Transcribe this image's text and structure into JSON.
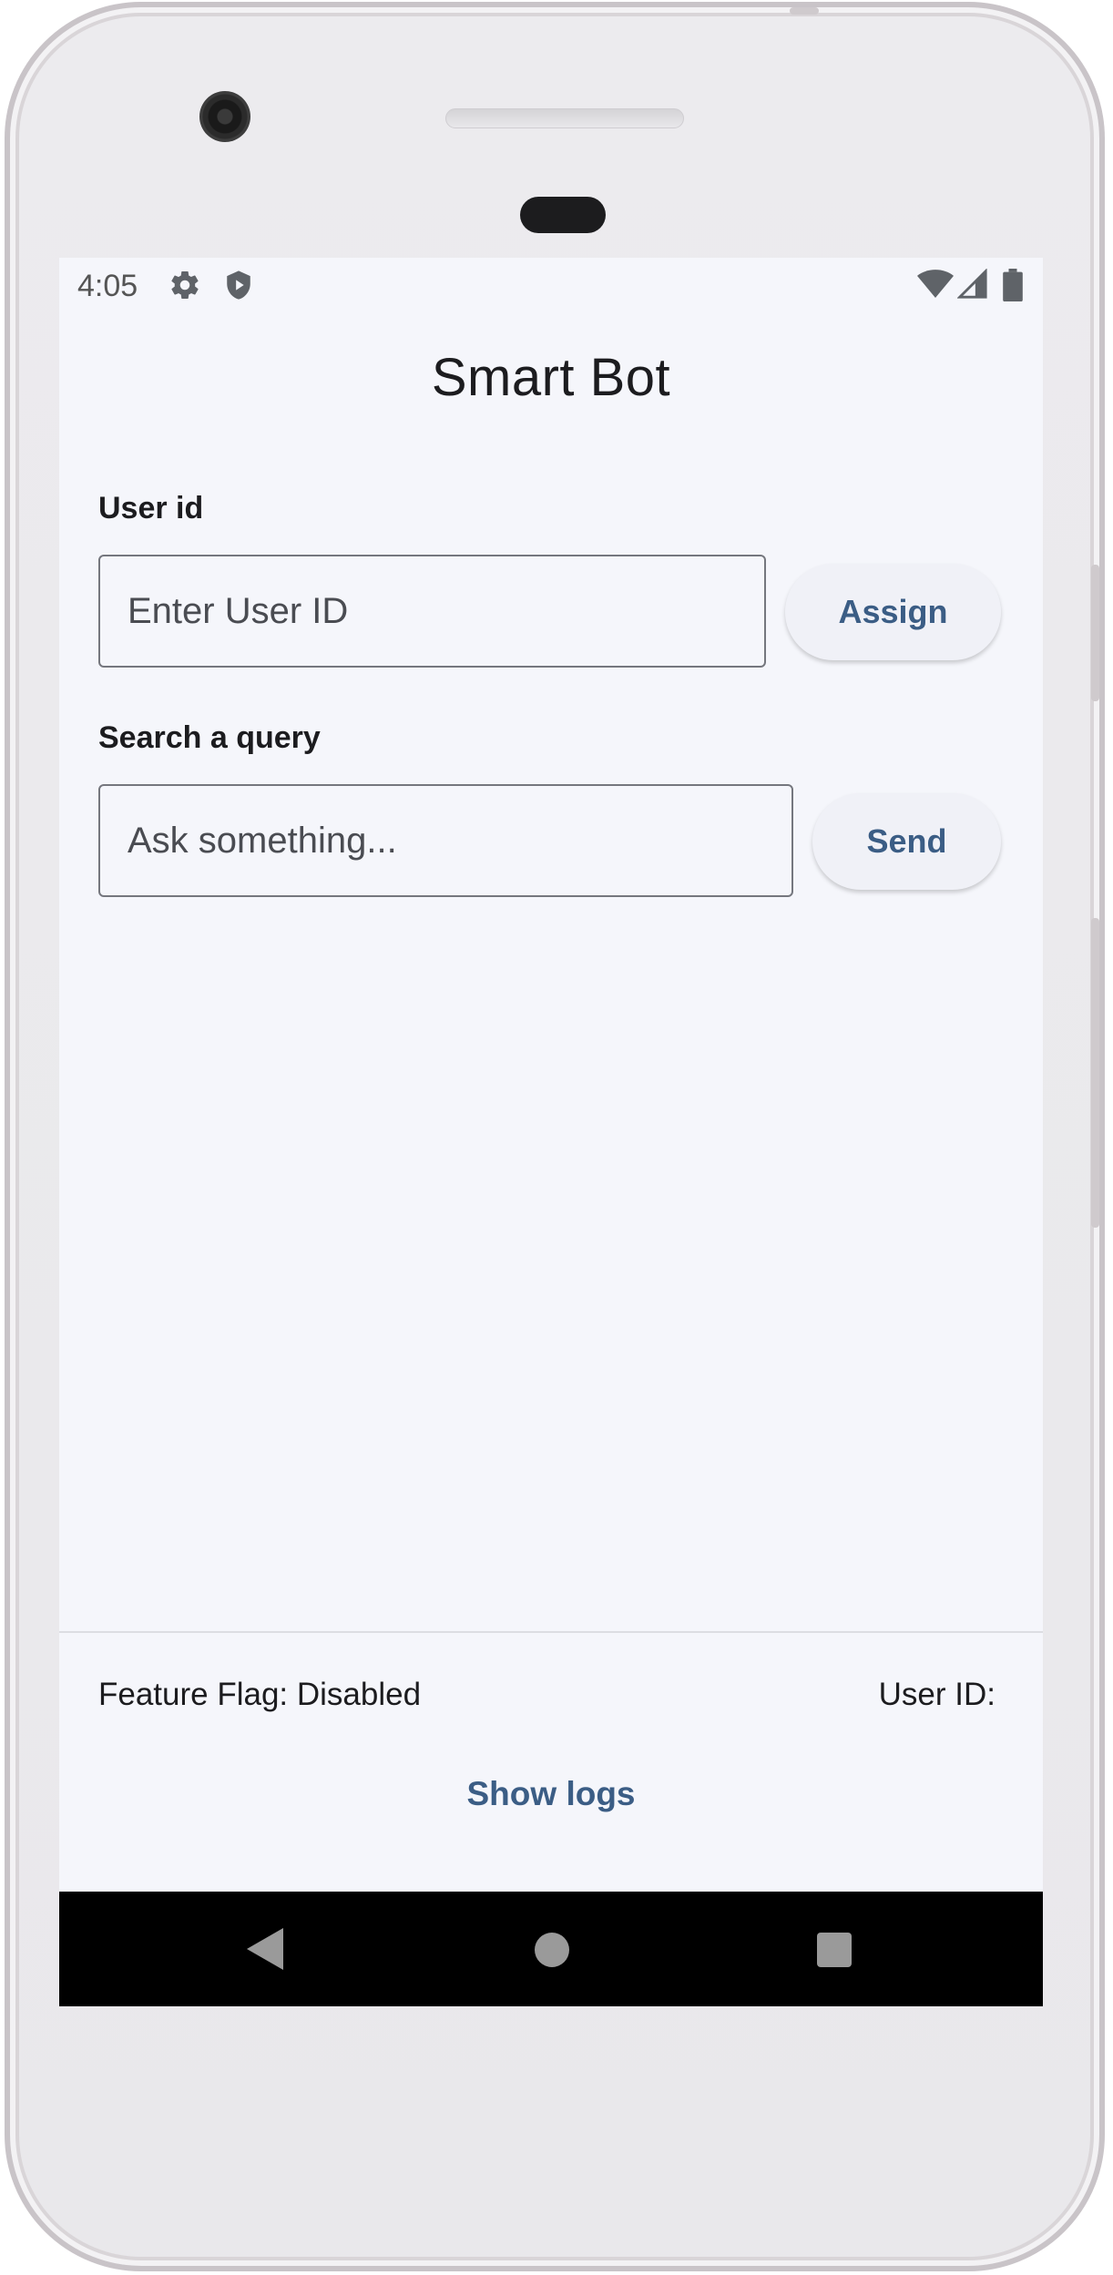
{
  "status_bar": {
    "time": "4:05",
    "icons": [
      "gear-icon",
      "shield-icon",
      "wifi-icon",
      "signal-icon",
      "battery-icon"
    ]
  },
  "app": {
    "title": "Smart Bot"
  },
  "user_section": {
    "label": "User id",
    "input_placeholder": "Enter User ID",
    "input_value": "",
    "button_label": "Assign"
  },
  "query_section": {
    "label": "Search a query",
    "input_placeholder": "Ask something...",
    "input_value": "",
    "button_label": "Send"
  },
  "footer": {
    "feature_flag": "Feature Flag: Disabled",
    "user_id": "User ID:",
    "show_logs": "Show logs"
  },
  "nav_bar": {
    "icons": [
      "back-icon",
      "home-icon",
      "recents-icon"
    ]
  },
  "colors": {
    "screen_bg": "#f5f6fb",
    "accent": "#3b5d85",
    "text": "#1c1c1f",
    "nav_bg": "#000000"
  }
}
